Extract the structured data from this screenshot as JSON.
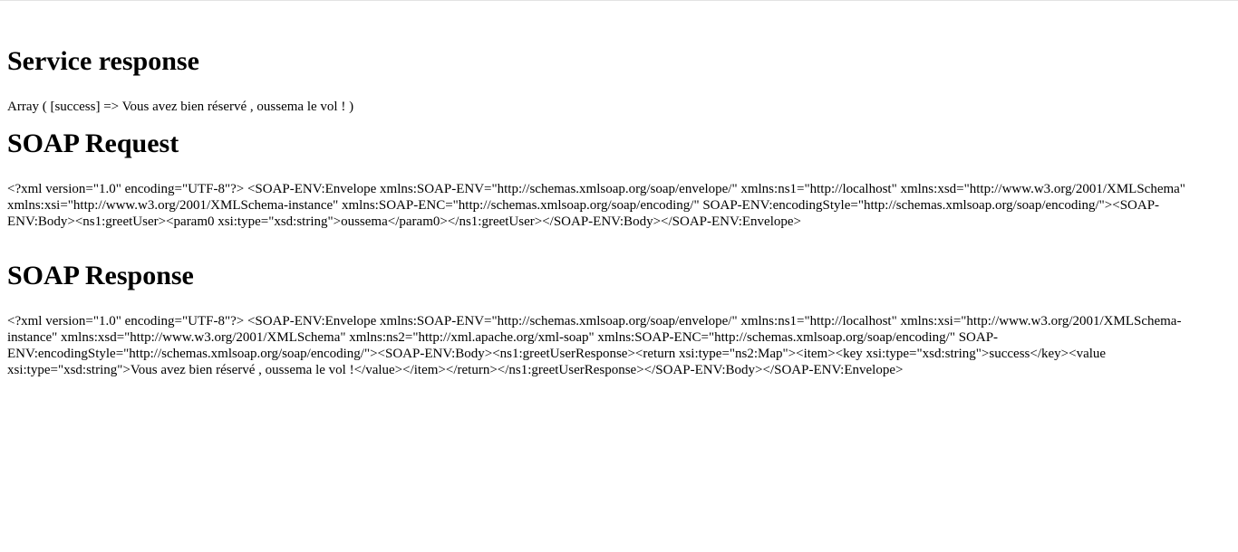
{
  "service_response": {
    "heading": "Service response",
    "array_text": "Array ( [success] => Vous avez bien réservé , oussema le vol ! )"
  },
  "soap_request": {
    "heading": "SOAP Request",
    "xml": "<?xml version=\"1.0\" encoding=\"UTF-8\"?> <SOAP-ENV:Envelope xmlns:SOAP-ENV=\"http://schemas.xmlsoap.org/soap/envelope/\" xmlns:ns1=\"http://localhost\" xmlns:xsd=\"http://www.w3.org/2001/XMLSchema\" xmlns:xsi=\"http://www.w3.org/2001/XMLSchema-instance\" xmlns:SOAP-ENC=\"http://schemas.xmlsoap.org/soap/encoding/\" SOAP-ENV:encodingStyle=\"http://schemas.xmlsoap.org/soap/encoding/\"><SOAP-ENV:Body><ns1:greetUser><param0 xsi:type=\"xsd:string\">oussema</param0></ns1:greetUser></SOAP-ENV:Body></SOAP-ENV:Envelope>"
  },
  "soap_response": {
    "heading": "SOAP Response",
    "xml": "<?xml version=\"1.0\" encoding=\"UTF-8\"?> <SOAP-ENV:Envelope xmlns:SOAP-ENV=\"http://schemas.xmlsoap.org/soap/envelope/\" xmlns:ns1=\"http://localhost\" xmlns:xsi=\"http://www.w3.org/2001/XMLSchema-instance\" xmlns:xsd=\"http://www.w3.org/2001/XMLSchema\" xmlns:ns2=\"http://xml.apache.org/xml-soap\" xmlns:SOAP-ENC=\"http://schemas.xmlsoap.org/soap/encoding/\" SOAP-ENV:encodingStyle=\"http://schemas.xmlsoap.org/soap/encoding/\"><SOAP-ENV:Body><ns1:greetUserResponse><return xsi:type=\"ns2:Map\"><item><key xsi:type=\"xsd:string\">success</key><value xsi:type=\"xsd:string\">Vous avez bien réservé , oussema le vol !</value></item></return></ns1:greetUserResponse></SOAP-ENV:Body></SOAP-ENV:Envelope>"
  }
}
